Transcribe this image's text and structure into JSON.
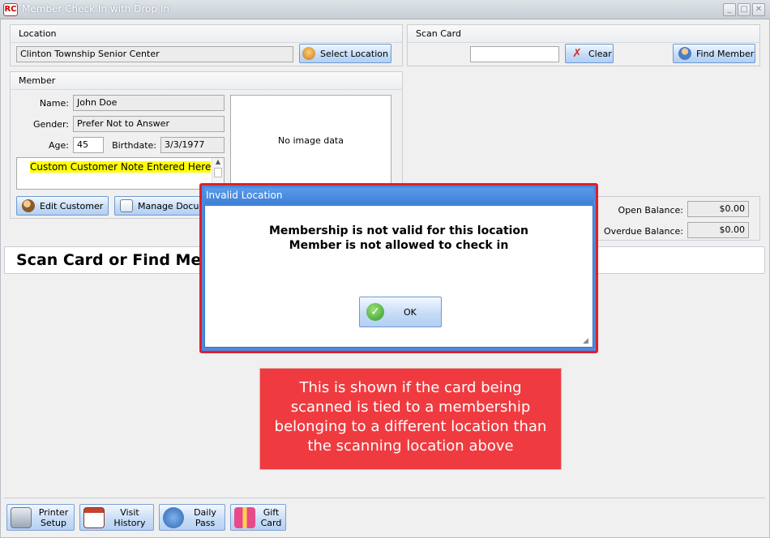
{
  "window": {
    "title": "Member Check In with Drop In",
    "app_icon_text": "RC",
    "minimize": "_",
    "maximize": "□",
    "close": "✕"
  },
  "location": {
    "title": "Location",
    "value": "Clinton Township Senior Center",
    "select_button": "Select Location"
  },
  "scan_card": {
    "title": "Scan Card",
    "input_value": "",
    "clear_button": "Clear",
    "find_member_button": "Find Member"
  },
  "member": {
    "title": "Member",
    "name_label": "Name:",
    "name_value": "John Doe",
    "gender_label": "Gender:",
    "gender_value": "Prefer Not to Answer",
    "age_label": "Age:",
    "age_value": "45",
    "birthdate_label": "Birthdate:",
    "birthdate_value": "3/3/1977",
    "note": "Custom Customer Note Entered Here",
    "image_placeholder": "No image data",
    "edit_customer_button": "Edit Customer",
    "manage_documents_button": "Manage Documents"
  },
  "balances": {
    "open_label": "Open Balance:",
    "open_value": "$0.00",
    "overdue_label": "Overdue Balance:",
    "overdue_value": "$0.00"
  },
  "status_banner": "Scan Card or Find Member",
  "dialog": {
    "title": "Invalid Location",
    "line1": "Membership is not valid for this location",
    "line2": "Member is not allowed to check in",
    "ok_button": "OK"
  },
  "callout": {
    "text": "This is shown if the card being scanned is tied to a membership belonging to a different location than the scanning location above"
  },
  "toolbar": {
    "printer_setup_line1": "Printer",
    "printer_setup_line2": "Setup",
    "visit_history_line1": "Visit",
    "visit_history_line2": "History",
    "daily_pass_line1": "Daily",
    "daily_pass_line2": "Pass",
    "gift_card_line1": "Gift",
    "gift_card_line2": "Card"
  },
  "colors": {
    "dialog_border": "#e21e27",
    "callout_bg": "#ef3b40",
    "note_highlight": "#ffff00",
    "button_border": "#6f9ad2"
  }
}
